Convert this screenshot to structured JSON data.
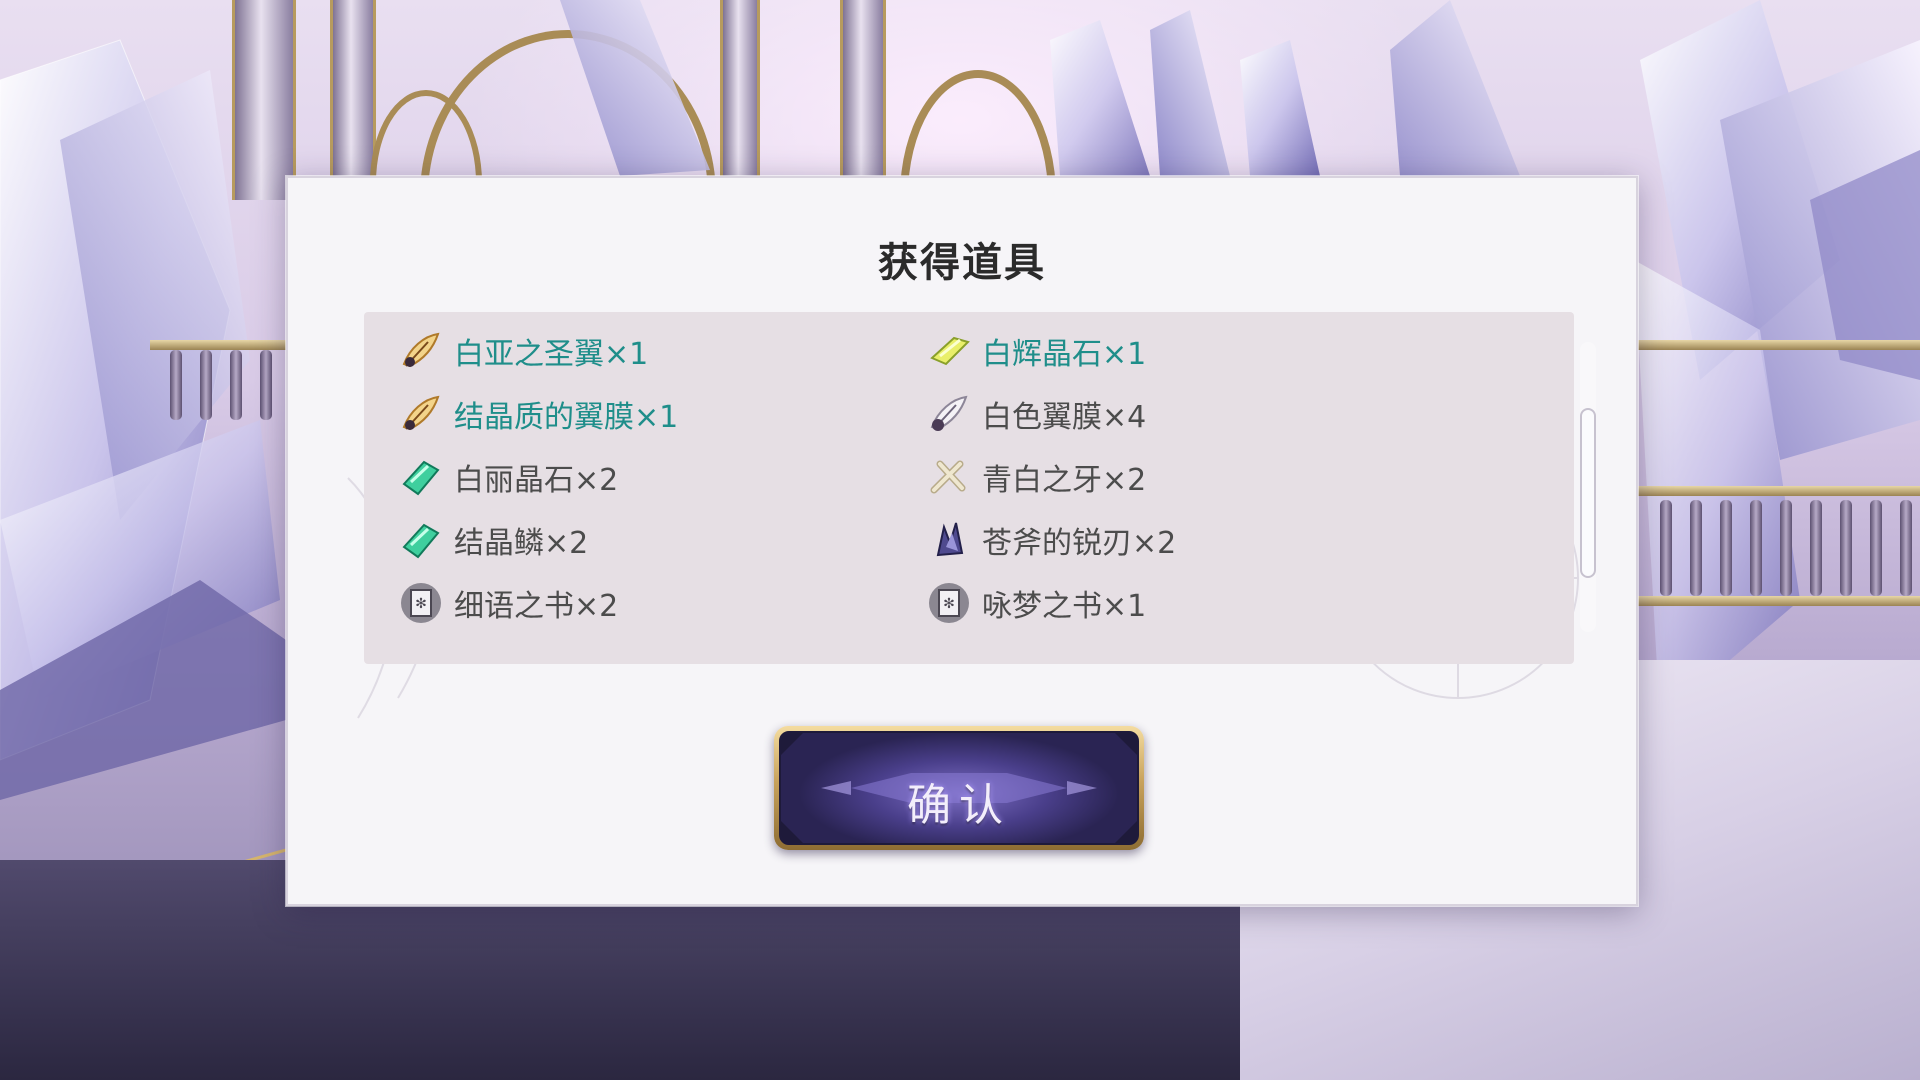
{
  "dialog": {
    "title": "获得道具",
    "confirm_label": "确认",
    "scroll_position": 0.55
  },
  "items": [
    {
      "name": "白亚之圣翼×1",
      "icon": "feather-gold-icon",
      "rare": true
    },
    {
      "name": "白辉晶石×1",
      "icon": "crystal-yellow-icon",
      "rare": true
    },
    {
      "name": "结晶质的翼膜×1",
      "icon": "feather-gold-icon",
      "rare": true
    },
    {
      "name": "白色翼膜×4",
      "icon": "feather-white-icon",
      "rare": false
    },
    {
      "name": "白丽晶石×2",
      "icon": "crystal-green-icon",
      "rare": false
    },
    {
      "name": "青白之牙×2",
      "icon": "fang-bone-icon",
      "rare": false
    },
    {
      "name": "结晶鳞×2",
      "icon": "crystal-green-icon",
      "rare": false
    },
    {
      "name": "苍斧的锐刃×2",
      "icon": "dark-crystal-icon",
      "rare": false
    },
    {
      "name": "细语之书×2",
      "icon": "book-icon",
      "rare": false
    },
    {
      "name": "咏梦之书×1",
      "icon": "book-icon",
      "rare": false
    }
  ],
  "colors": {
    "rare_text": "#1f8e8a",
    "normal_text": "#4c4c4c",
    "panel_bg": "#e6dfe4",
    "dialog_bg": "#f6f5f8"
  }
}
